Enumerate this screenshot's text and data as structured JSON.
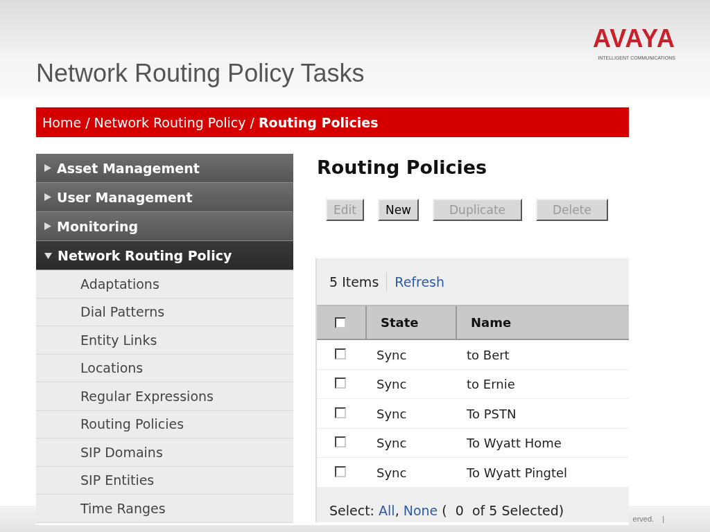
{
  "slide": {
    "title": "Network Routing Policy Tasks",
    "logo": "AVAYA",
    "tagline": "INTELLIGENT COMMUNICATIONS",
    "footer": "erved.",
    "footer_separator": "|"
  },
  "breadcrumb": "Home / Network Routing Policy / **Routing Policies**",
  "sidebar": {
    "items": [
      {
        "label": "Asset Management",
        "expanded": false
      },
      {
        "label": "User Management",
        "expanded": false
      },
      {
        "label": "Monitoring",
        "expanded": false
      },
      {
        "label": "Network Routing Policy",
        "expanded": true,
        "children": [
          {
            "label": "Adaptations"
          },
          {
            "label": "Dial Patterns"
          },
          {
            "label": "Entity Links"
          },
          {
            "label": "Locations"
          },
          {
            "label": "Regular Expressions"
          },
          {
            "label": "Routing Policies"
          },
          {
            "label": "SIP Domains"
          },
          {
            "label": "SIP Entities"
          },
          {
            "label": "Time Ranges"
          }
        ]
      }
    ]
  },
  "page_title": "Routing Policies",
  "buttons": [
    {
      "label": "Edit",
      "disabled": true
    },
    {
      "label": "New",
      "disabled": false
    },
    {
      "label": "Duplicate",
      "disabled": true
    },
    {
      "label": "Delete",
      "disabled": true
    }
  ],
  "table": {
    "count": "5 Items",
    "refresh": "Refresh",
    "all_checked": false,
    "columns": [
      "State",
      "Name"
    ],
    "rows": [
      {
        "checked": false,
        "state": "Sync",
        "name": "to Bert"
      },
      {
        "checked": false,
        "state": "Sync",
        "name": "to Ernie"
      },
      {
        "checked": false,
        "state": "Sync",
        "name": "To PSTN"
      },
      {
        "checked": false,
        "state": "Sync",
        "name": "To Wyatt Home"
      },
      {
        "checked": false,
        "state": "Sync",
        "name": "To Wyatt Pingtel"
      }
    ],
    "select_label": "Select:",
    "select_all": "All",
    "comma": ",",
    "select_none": "None",
    "selection": "(  0  of 5 Selected)"
  }
}
